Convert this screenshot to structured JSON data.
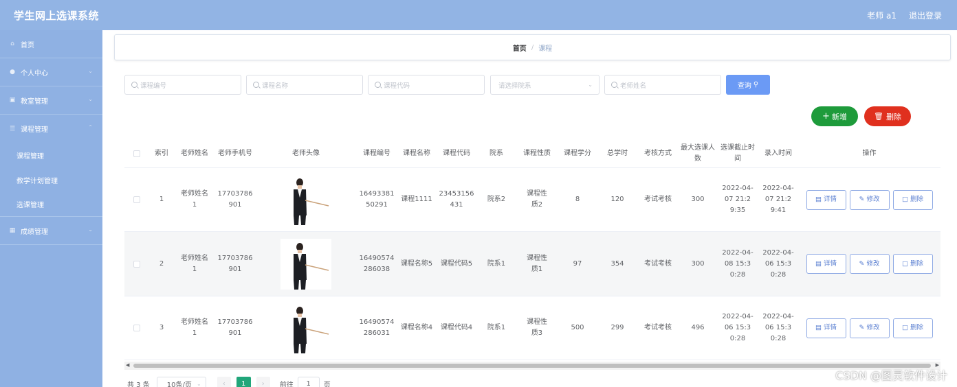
{
  "app": {
    "title": "学生网上选课系统"
  },
  "topbar": {
    "user": "老师 a1",
    "logout": "退出登录"
  },
  "sidebar": {
    "items": [
      {
        "label": "首页",
        "icon": "home-icon"
      },
      {
        "label": "个人中心",
        "icon": "user-icon"
      },
      {
        "label": "教室管理",
        "icon": "classroom-icon"
      },
      {
        "label": "课程管理",
        "icon": "list-icon"
      },
      {
        "label": "成绩管理",
        "icon": "grade-icon"
      }
    ],
    "subitems": [
      {
        "label": "课程管理"
      },
      {
        "label": "教学计划管理"
      },
      {
        "label": "选课管理"
      }
    ]
  },
  "breadcrumb": {
    "home": "首页",
    "sep": "/",
    "current": "课程"
  },
  "search": {
    "course_no": "课程编号",
    "course_name": "课程名称",
    "course_code": "课程代码",
    "department": "请选择院系",
    "teacher_name": "老师姓名",
    "query_label": "查询"
  },
  "actions": {
    "add_label": "新增",
    "delete_label": "删除"
  },
  "table": {
    "headers": {
      "index": "索引",
      "teacher_name": "老师姓名",
      "teacher_phone": "老师手机号",
      "teacher_avatar": "老师头像",
      "course_no": "课程编号",
      "course_name": "课程名称",
      "course_code": "课程代码",
      "department": "院系",
      "course_nature": "课程性质",
      "credits": "课程学分",
      "total_hours": "总学时",
      "exam_method": "考核方式",
      "max_students": "最大选课人数",
      "deadline": "选课截止时间",
      "entry_time": "录入时间",
      "ops": "操作"
    },
    "ops": {
      "detail": "详情",
      "edit": "修改",
      "delete": "删除"
    },
    "rows": [
      {
        "index": "1",
        "teacher_name": "老师姓名1",
        "teacher_phone": "17703786901",
        "course_no": "1649338150291",
        "course_name": "课程1111",
        "course_code": "23453156431",
        "department": "院系2",
        "course_nature": "课程性质2",
        "credits": "8",
        "total_hours": "120",
        "exam_method": "考试考核",
        "max_students": "300",
        "deadline": "2022-04-07 21:29:35",
        "entry_time": "2022-04-07 21:29:41"
      },
      {
        "index": "2",
        "teacher_name": "老师姓名1",
        "teacher_phone": "17703786901",
        "course_no": "16490574286038",
        "course_name": "课程名称5",
        "course_code": "课程代码5",
        "department": "院系1",
        "course_nature": "课程性质1",
        "credits": "97",
        "total_hours": "354",
        "exam_method": "考试考核",
        "max_students": "300",
        "deadline": "2022-04-08 15:30:28",
        "entry_time": "2022-04-06 15:30:28"
      },
      {
        "index": "3",
        "teacher_name": "老师姓名1",
        "teacher_phone": "17703786901",
        "course_no": "16490574286031",
        "course_name": "课程名称4",
        "course_code": "课程代码4",
        "department": "院系1",
        "course_nature": "课程性质3",
        "credits": "500",
        "total_hours": "299",
        "exam_method": "考试考核",
        "max_students": "496",
        "deadline": "2022-04-06 15:30:28",
        "entry_time": "2022-04-06 15:30:28"
      }
    ]
  },
  "pagination": {
    "total": "共 3 条",
    "page_size": "10条/页",
    "prev": "‹",
    "page": "1",
    "next": "›",
    "goto_prefix": "前往",
    "goto_value": "1",
    "goto_suffix": "页"
  },
  "watermark": "CSDN @图灵软件设计",
  "colors": {
    "topbar": "#92b4e4",
    "sidebar": "#8fb1e3",
    "query": "#6b9af5",
    "add": "#1e9b3b",
    "delete": "#e0301e",
    "page_active": "#21a67a"
  }
}
